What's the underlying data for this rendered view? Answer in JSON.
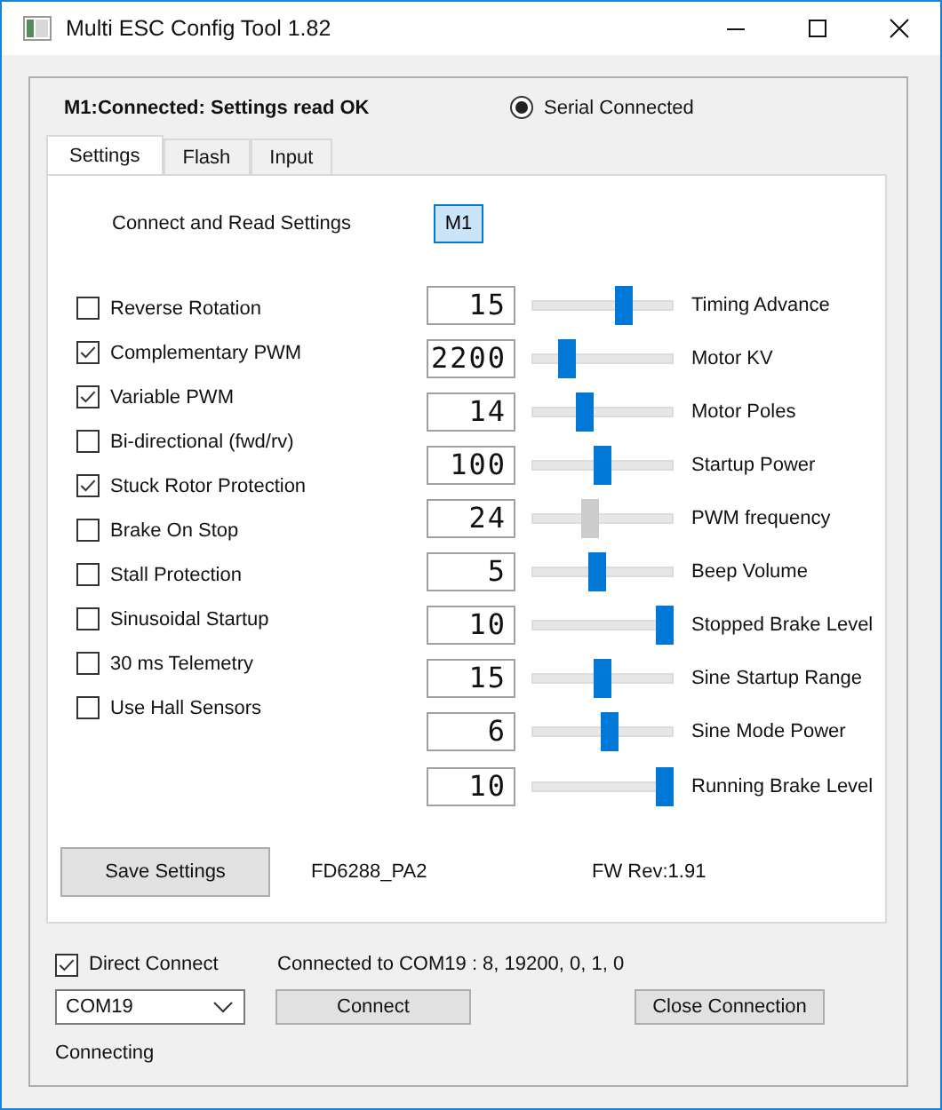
{
  "window": {
    "title": "Multi ESC Config Tool 1.82"
  },
  "status": "M1:Connected: Settings read OK",
  "serial_connected": {
    "label": "Serial Connected",
    "selected": true
  },
  "tabs": [
    {
      "label": "Settings",
      "selected": true
    },
    {
      "label": "Flash",
      "selected": false
    },
    {
      "label": "Input",
      "selected": false
    }
  ],
  "connect_read": {
    "label": "Connect and Read Settings",
    "button": "M1"
  },
  "options": [
    {
      "label": "Reverse Rotation",
      "checked": false
    },
    {
      "label": "Complementary PWM",
      "checked": true
    },
    {
      "label": "Variable PWM",
      "checked": true
    },
    {
      "label": "Bi-directional (fwd/rv)",
      "checked": false
    },
    {
      "label": "Stuck Rotor Protection",
      "checked": true
    },
    {
      "label": "Brake On Stop",
      "checked": false
    },
    {
      "label": "Stall Protection",
      "checked": false
    },
    {
      "label": "Sinusoidal Startup",
      "checked": false
    },
    {
      "label": "30 ms Telemetry",
      "checked": false
    },
    {
      "label": "Use Hall Sensors",
      "checked": false
    }
  ],
  "parameters": [
    {
      "value": "15",
      "level": 0.67,
      "label": "Timing Advance",
      "disabled": false
    },
    {
      "value": "2200",
      "level": 0.21,
      "label": "Motor KV",
      "disabled": false
    },
    {
      "value": "14",
      "level": 0.36,
      "label": "Motor Poles",
      "disabled": false
    },
    {
      "value": "100",
      "level": 0.5,
      "label": "Startup Power",
      "disabled": false
    },
    {
      "value": "24",
      "level": 0.4,
      "label": "PWM frequency",
      "disabled": true
    },
    {
      "value": "5",
      "level": 0.46,
      "label": "Beep Volume",
      "disabled": false
    },
    {
      "value": "10",
      "level": 1,
      "label": "Stopped Brake Level",
      "disabled": false
    },
    {
      "value": "15",
      "level": 0.5,
      "label": "Sine Startup Range",
      "disabled": false
    },
    {
      "value": "6",
      "level": 0.55,
      "label": "Sine Mode Power",
      "disabled": false
    },
    {
      "value": "10",
      "level": 1,
      "label": "Running Brake Level",
      "disabled": false
    }
  ],
  "save_button": "Save Settings",
  "esc_target": "FD6288_PA2",
  "firmware": "FW Rev:1.91",
  "direct_connect": {
    "label": "Direct Connect",
    "checked": true
  },
  "connection_info": "Connected to COM19 : 8, 19200, 0, 1, 0",
  "port": {
    "value": "COM19"
  },
  "connect_button": "Connect",
  "close_button": "Close Connection",
  "connection_status": "Connecting"
}
